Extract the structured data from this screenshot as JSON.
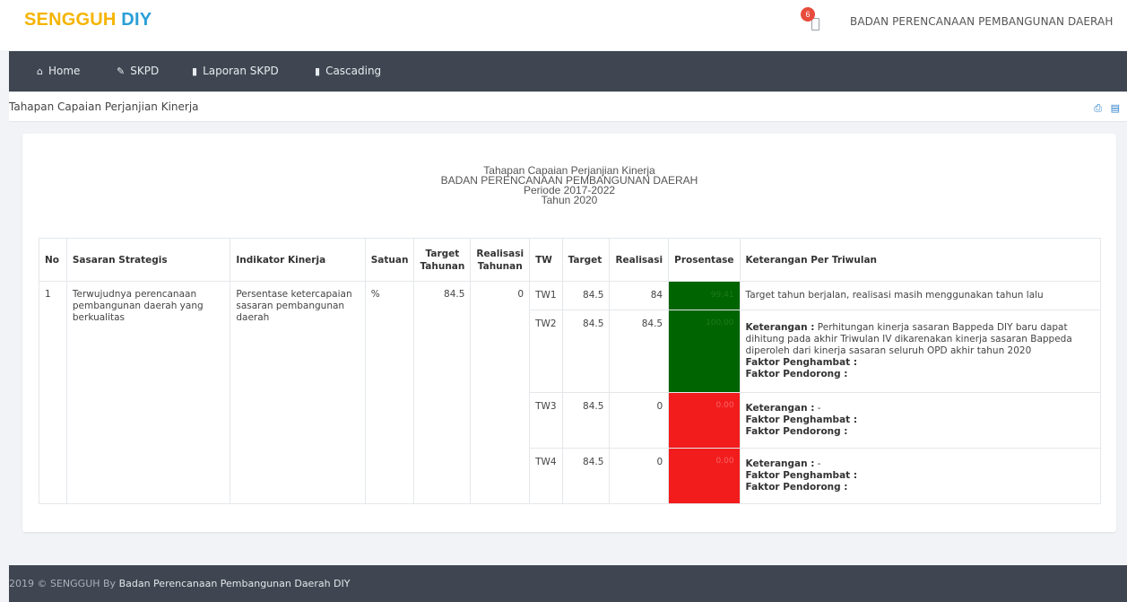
{
  "brand": {
    "part1": "SENGGUH",
    "part2": "DIY"
  },
  "notifications": {
    "count": "6"
  },
  "header_org": "BADAN PERENCANAAN PEMBANGUNAN DAERAH",
  "nav": {
    "items": [
      {
        "label": "Home",
        "icon": "home-icon"
      },
      {
        "label": "SKPD",
        "icon": "edit-icon"
      },
      {
        "label": "Laporan SKPD",
        "icon": "book-icon"
      },
      {
        "label": "Cascading",
        "icon": "book-icon"
      }
    ]
  },
  "page_title": "Tahapan Capaian Perjanjian Kinerja",
  "toolbar": {
    "print_icon": "print-icon",
    "export_icon": "pdf-icon"
  },
  "report": {
    "title": "Tahapan Capaian Perjanjian Kinerja",
    "org": "BADAN PERENCANAAN PEMBANGUNAN DAERAH",
    "period": "Periode 2017-2022",
    "year": "Tahun 2020"
  },
  "table": {
    "headers": {
      "no": "No",
      "sasaran": "Sasaran Strategis",
      "indikator": "Indikator Kinerja",
      "satuan": "Satuan",
      "target_tahunan": "Target Tahunan",
      "realisasi_tahunan": "Realisasi Tahunan",
      "tw": "TW",
      "target": "Target",
      "realisasi": "Realisasi",
      "prosentase": "Prosentase",
      "keterangan": "Keterangan Per Triwulan"
    },
    "row": {
      "no": "1",
      "sasaran": "Terwujudnya perencanaan pembangunan daerah yang berkualitas",
      "indikator": "Persentase ketercapaian sasaran pembangunan daerah",
      "satuan": "%",
      "target_tahunan": "84.5",
      "realisasi_tahunan": "0"
    },
    "quarters": [
      {
        "tw": "TW1",
        "target": "84.5",
        "realisasi": "84",
        "prosentase": "99.41",
        "status_color": "#006400",
        "keterangan_text": "Target tahun berjalan, realisasi masih menggunakan tahun lalu"
      },
      {
        "tw": "TW2",
        "target": "84.5",
        "realisasi": "84.5",
        "prosentase": "100.00",
        "status_color": "#006400",
        "keterangan_label": "Keterangan :",
        "keterangan_value": " Perhitungan kinerja sasaran Bappeda DIY baru dapat dihitung pada akhir Triwulan IV dikarenakan kinerja sasaran Bappeda diperoleh dari kinerja sasaran seluruh OPD akhir tahun 2020",
        "penghambat_label": "Faktor Penghambat :",
        "pendorong_label": "Faktor Pendorong :"
      },
      {
        "tw": "TW3",
        "target": "84.5",
        "realisasi": "0",
        "prosentase": "0.00",
        "status_color": "#f21c1c",
        "keterangan_label": "Keterangan :",
        "keterangan_value": " -",
        "penghambat_label": "Faktor Penghambat :",
        "pendorong_label": "Faktor Pendorong :"
      },
      {
        "tw": "TW4",
        "target": "84.5",
        "realisasi": "0",
        "prosentase": "0.00",
        "status_color": "#f21c1c",
        "keterangan_label": "Keterangan :",
        "keterangan_value": " -",
        "penghambat_label": "Faktor Penghambat :",
        "pendorong_label": "Faktor Pendorong :"
      }
    ]
  },
  "footer": {
    "prefix": "2019 © SENGGUH By ",
    "org": "Badan Perencanaan Pembangunan Daerah DIY"
  },
  "colors": {
    "brand_yellow": "#f5b400",
    "brand_blue": "#2a9fd6",
    "nav_bg": "#3f4651",
    "good": "#006400",
    "bad": "#f21c1c"
  }
}
